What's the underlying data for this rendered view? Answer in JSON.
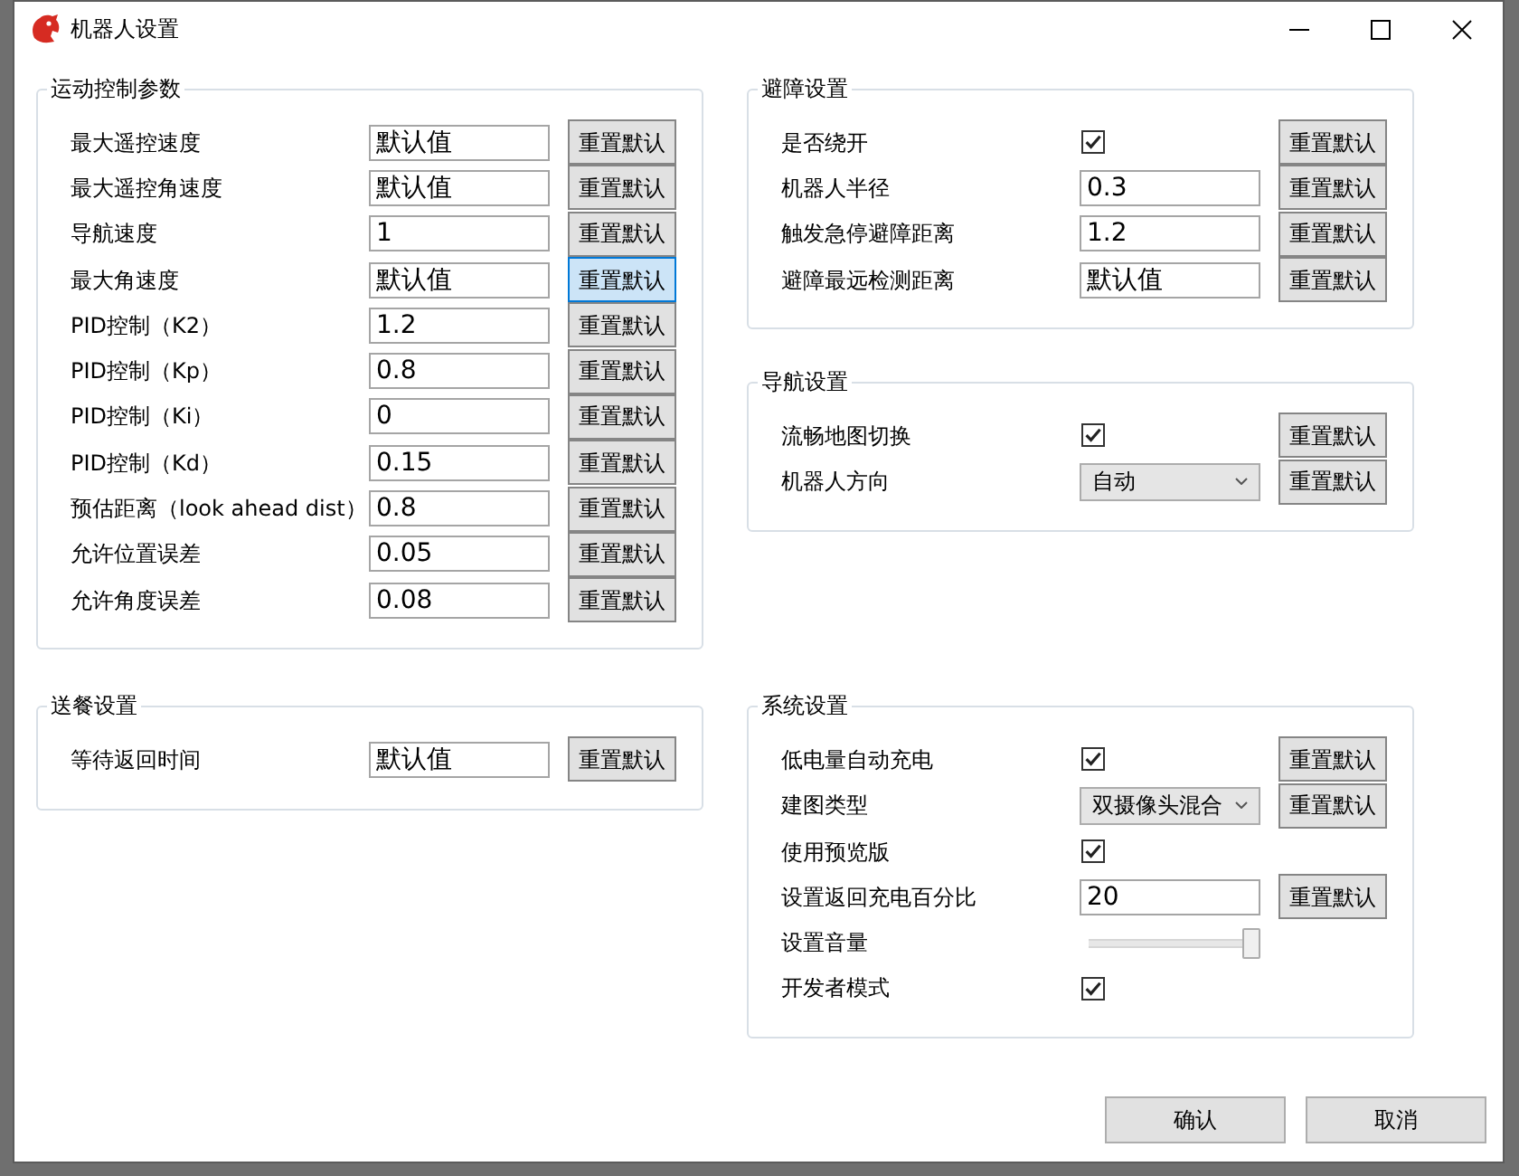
{
  "window": {
    "title": "机器人设置"
  },
  "sections": [
    {
      "left": [
        {
          "title": "运动控制参数",
          "rows": [
            {
              "kind": "text",
              "label": "最大遥控速度",
              "value": "默认值",
              "reset": {
                "label": "重置默认",
                "highlighted": false
              }
            },
            {
              "kind": "text",
              "label": "最大遥控角速度",
              "value": "默认值",
              "reset": {
                "label": "重置默认",
                "highlighted": false
              }
            },
            {
              "kind": "text",
              "label": "导航速度",
              "value": "1",
              "reset": {
                "label": "重置默认",
                "highlighted": false
              }
            },
            {
              "kind": "text",
              "label": "最大角速度",
              "value": "默认值",
              "reset": {
                "label": "重置默认",
                "highlighted": true
              }
            },
            {
              "kind": "text",
              "label": "PID控制（K2）",
              "value": "1.2",
              "reset": {
                "label": "重置默认",
                "highlighted": false
              }
            },
            {
              "kind": "text",
              "label": "PID控制（Kp）",
              "value": "0.8",
              "reset": {
                "label": "重置默认",
                "highlighted": false
              }
            },
            {
              "kind": "text",
              "label": "PID控制（Ki）",
              "value": "0",
              "reset": {
                "label": "重置默认",
                "highlighted": false
              }
            },
            {
              "kind": "text",
              "label": "PID控制（Kd）",
              "value": "0.15",
              "reset": {
                "label": "重置默认",
                "highlighted": false
              }
            },
            {
              "kind": "text",
              "label": "预估距离（look ahead dist）",
              "value": "0.8",
              "reset": {
                "label": "重置默认",
                "highlighted": false
              }
            },
            {
              "kind": "text",
              "label": "允许位置误差",
              "value": "0.05",
              "reset": {
                "label": "重置默认",
                "highlighted": false
              }
            },
            {
              "kind": "text",
              "label": "允许角度误差",
              "value": "0.08",
              "reset": {
                "label": "重置默认",
                "highlighted": false
              }
            }
          ]
        }
      ],
      "right": [
        {
          "title": "避障设置",
          "rows": [
            {
              "kind": "checkbox",
              "label": "是否绕开",
              "checked": true,
              "reset": {
                "label": "重置默认",
                "highlighted": false
              }
            },
            {
              "kind": "text",
              "label": "机器人半径",
              "value": "0.3",
              "reset": {
                "label": "重置默认",
                "highlighted": false
              }
            },
            {
              "kind": "text",
              "label": "触发急停避障距离",
              "value": "1.2",
              "reset": {
                "label": "重置默认",
                "highlighted": false
              }
            },
            {
              "kind": "text",
              "label": "避障最远检测距离",
              "value": "默认值",
              "reset": {
                "label": "重置默认",
                "highlighted": false
              }
            }
          ]
        },
        {
          "title": "导航设置",
          "rows": [
            {
              "kind": "checkbox",
              "label": "流畅地图切换",
              "checked": true,
              "reset": {
                "label": "重置默认",
                "highlighted": false
              }
            },
            {
              "kind": "select",
              "label": "机器人方向",
              "value": "自动",
              "reset": {
                "label": "重置默认",
                "highlighted": false
              }
            }
          ]
        }
      ]
    },
    {
      "left": [
        {
          "title": "送餐设置",
          "rows": [
            {
              "kind": "text",
              "label": "等待返回时间",
              "value": "默认值",
              "reset": {
                "label": "重置默认",
                "highlighted": false
              }
            }
          ]
        }
      ],
      "right": [
        {
          "title": "系统设置",
          "rows": [
            {
              "kind": "checkbox",
              "label": "低电量自动充电",
              "checked": true,
              "reset": {
                "label": "重置默认",
                "highlighted": false
              }
            },
            {
              "kind": "select",
              "label": "建图类型",
              "value": "双摄像头混合",
              "reset": {
                "label": "重置默认",
                "highlighted": false
              }
            },
            {
              "kind": "checkbox",
              "label": "使用预览版",
              "checked": true
            },
            {
              "kind": "text",
              "label": "设置返回充电百分比",
              "value": "20",
              "reset": {
                "label": "重置默认",
                "highlighted": false
              }
            },
            {
              "kind": "slider",
              "label": "设置音量",
              "level": 1
            },
            {
              "kind": "checkbox",
              "label": "开发者模式",
              "checked": true
            }
          ]
        }
      ]
    }
  ],
  "buttons": [
    {
      "label": "确认"
    },
    {
      "label": "取消"
    }
  ]
}
